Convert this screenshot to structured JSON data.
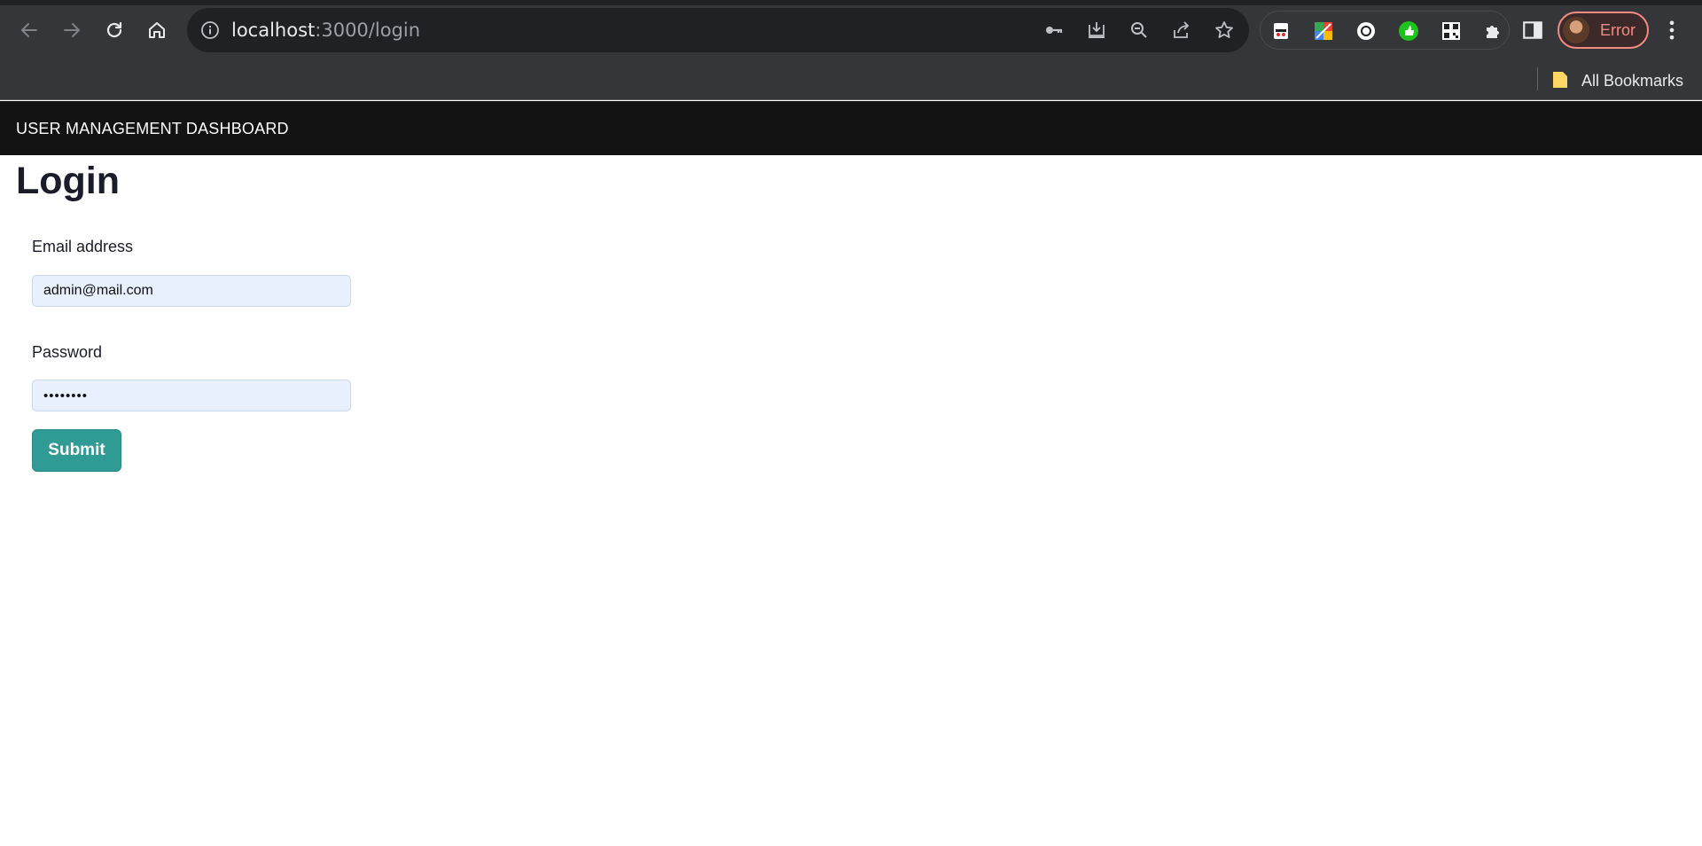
{
  "browser": {
    "url_host": "localhost",
    "url_path": ":3000/login",
    "profile_label": "Error",
    "bookmarks_label": "All Bookmarks"
  },
  "app": {
    "brand": "USER MANAGEMENT DASHBOARD"
  },
  "login": {
    "title": "Login",
    "email_label": "Email address",
    "email_value": "admin@mail.com",
    "password_label": "Password",
    "password_value": "••••••••",
    "submit_label": "Submit"
  },
  "colors": {
    "navbar": "#131313",
    "accent": "#2f9b94",
    "input_bg": "#e8f0fe",
    "profile_error": "#f28b82"
  }
}
